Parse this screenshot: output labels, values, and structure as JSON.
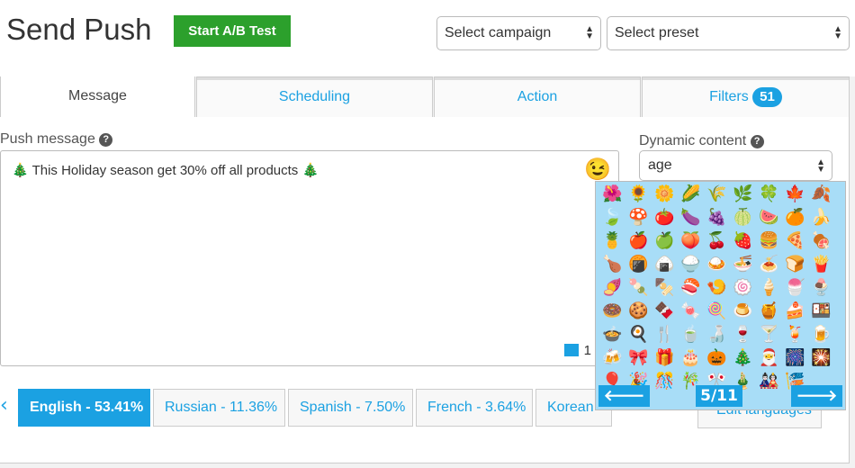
{
  "header": {
    "title": "Send Push",
    "ab_test_label": "Start A/B Test",
    "campaign_select": "Select campaign",
    "preset_select": "Select preset"
  },
  "tabs": [
    {
      "label": "Message"
    },
    {
      "label": "Scheduling"
    },
    {
      "label": "Action"
    },
    {
      "label": "Filters",
      "badge": "51"
    }
  ],
  "message": {
    "label": "Push message",
    "text": "🎄 This Holiday season get 30% off all products 🎄",
    "char_count": "1",
    "emoji_button": "😉"
  },
  "dynamic": {
    "label": "Dynamic content",
    "value": "age"
  },
  "emoji_picker": {
    "page": "5/11",
    "prev": "🡐",
    "next": "🡒",
    "emojis": [
      "🌺",
      "🌻",
      "🌼",
      "🌽",
      "🌾",
      "🌿",
      "🍀",
      "🍁",
      "🍂",
      "🍃",
      "🍄",
      "🍅",
      "🍆",
      "🍇",
      "🍈",
      "🍉",
      "🍊",
      "🍌",
      "🍍",
      "🍎",
      "🍏",
      "🍑",
      "🍒",
      "🍓",
      "🍔",
      "🍕",
      "🍖",
      "🍗",
      "🍘",
      "🍙",
      "🍚",
      "🍛",
      "🍜",
      "🍝",
      "🍞",
      "🍟",
      "🍠",
      "🍡",
      "🍢",
      "🍣",
      "🍤",
      "🍥",
      "🍦",
      "🍧",
      "🍨",
      "🍩",
      "🍪",
      "🍫",
      "🍬",
      "🍭",
      "🍮",
      "🍯",
      "🍰",
      "🍱",
      "🍲",
      "🍳",
      "🍴",
      "🍵",
      "🍶",
      "🍷",
      "🍸",
      "🍹",
      "🍺",
      "🍻",
      "🎀",
      "🎁",
      "🎂",
      "🎃",
      "🎄",
      "🎅",
      "🎆",
      "🎇",
      "🎈",
      "🎉",
      "🎊",
      "🎋",
      "🎌",
      "🎍",
      "🎎",
      "🎏"
    ]
  },
  "languages": [
    {
      "label": "English - 53.41%"
    },
    {
      "label": "Russian - 11.36%"
    },
    {
      "label": "Spanish - 7.50%"
    },
    {
      "label": "French - 3.64%"
    },
    {
      "label": "Korean"
    }
  ],
  "edit_languages": "Edit languages",
  "accent": "#1ba1e2"
}
